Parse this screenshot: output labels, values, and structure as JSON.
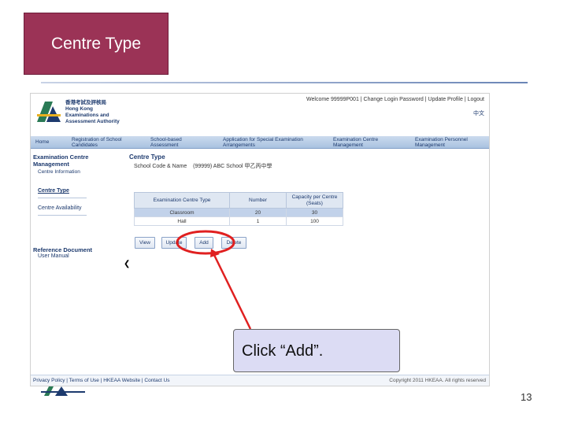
{
  "slide": {
    "title": "Centre Type",
    "callout": "Click “Add”.",
    "page_number": "13"
  },
  "app": {
    "org_name": [
      "香港考試及評核局",
      "Hong Kong",
      "Examinations and",
      "Assessment Authority"
    ],
    "top_links": "Welcome 99999P001 | Change Login Password | Update Profile | Logout",
    "lang_toggle": "中文",
    "nav": [
      {
        "line1": "Home",
        "line2": ""
      },
      {
        "line1": "Registration of School",
        "line2": "Candidates"
      },
      {
        "line1": "School-based",
        "line2": "Assessment"
      },
      {
        "line1": "Application for Special Examination",
        "line2": "Arrangements"
      },
      {
        "line1": "Examination Centre",
        "line2": "Management"
      },
      {
        "line1": "Examination Personnel",
        "line2": "Management"
      }
    ],
    "sidebar": {
      "section_title_1": "Examination Centre",
      "section_title_2": "Management",
      "sub_title": "Centre Information",
      "items": [
        {
          "label": "Centre Type"
        },
        {
          "label": "Centre Availability"
        }
      ],
      "ref_title": "Reference Document",
      "ref_link": "User Manual"
    },
    "main": {
      "page_title": "Centre Type",
      "school_label": "School Code & Name",
      "school_value": "(99999)  ABC School 甲乙丙中學",
      "table": {
        "headers": [
          "Examination Centre Type",
          "Number",
          "Capacity per Centre (Seats)"
        ],
        "rows": [
          [
            "Classroom",
            "20",
            "30"
          ],
          [
            "Hall",
            "1",
            "100"
          ]
        ]
      },
      "buttons": {
        "view": "View",
        "update": "Update",
        "add": "Add",
        "delete": "Delete"
      }
    },
    "footer": {
      "links": "Privacy Policy | Terms of Use | HKEAA Website | Contact Us",
      "copyright": "Copyright 2011 HKEAA. All rights reserved"
    }
  },
  "colors": {
    "title_bg": "#9b3356",
    "nav_bg": "#a9c2e0",
    "highlight": "#e02020",
    "callout_bg": "#dcdcf4"
  }
}
